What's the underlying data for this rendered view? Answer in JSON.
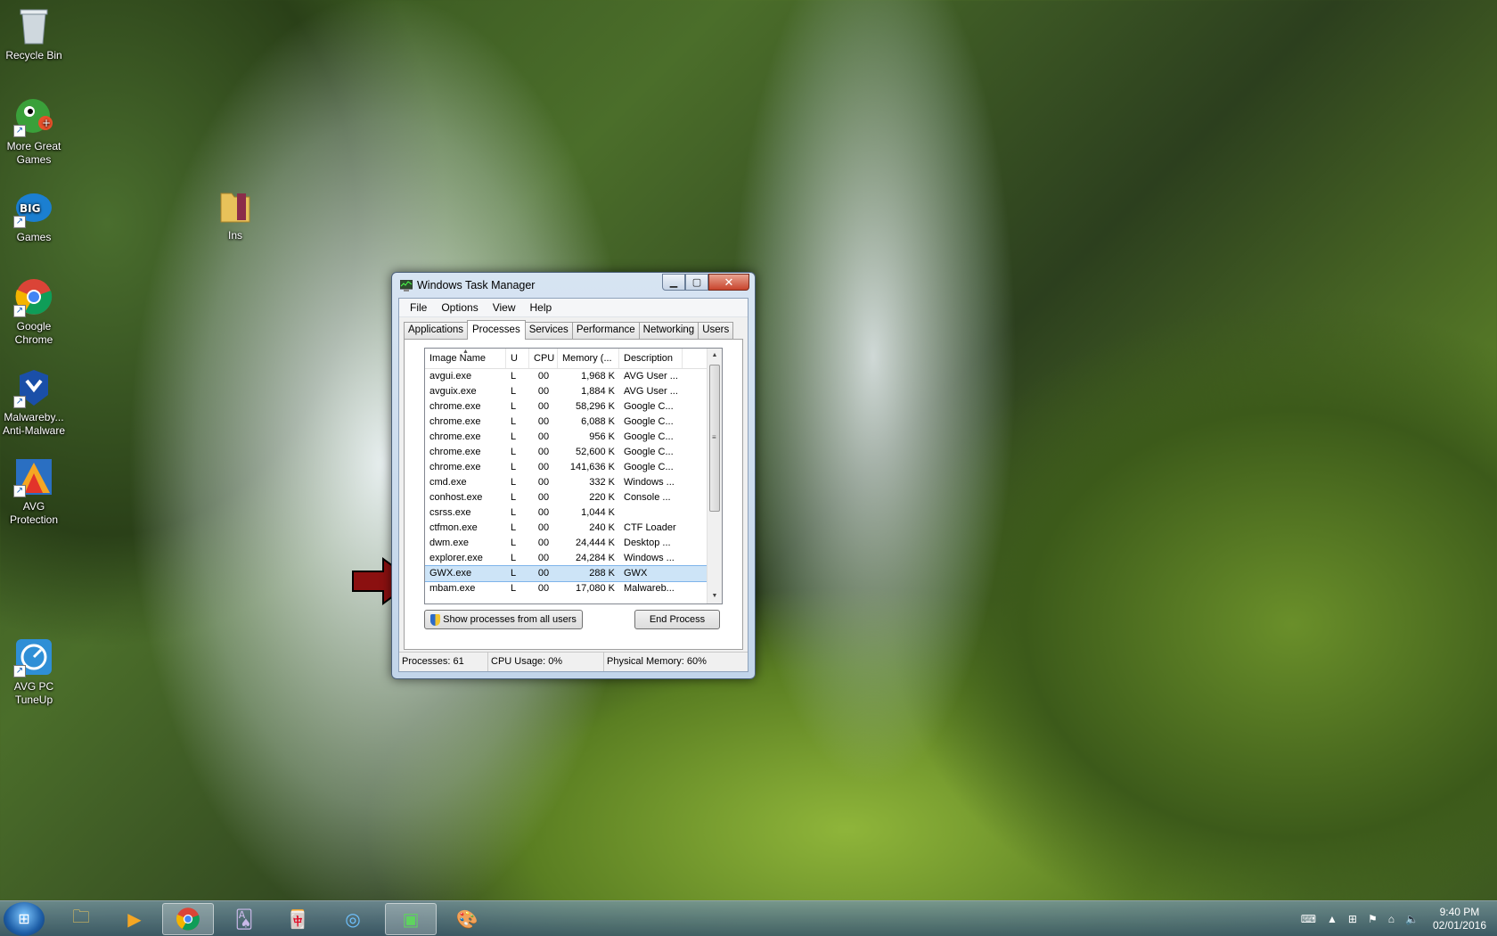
{
  "desktop": {
    "icons": [
      {
        "label": "Recycle Bin"
      },
      {
        "label": "More Great\nGames"
      },
      {
        "label": "Games"
      },
      {
        "label": "Google\nChrome"
      },
      {
        "label": "Malwareby...\nAnti-Malware"
      },
      {
        "label": "AVG\nProtection"
      },
      {
        "label": "AVG PC\nTuneUp"
      },
      {
        "label": "Ins"
      }
    ]
  },
  "window": {
    "title": "Windows Task Manager",
    "menu": [
      "File",
      "Options",
      "View",
      "Help"
    ],
    "tabs": [
      "Applications",
      "Processes",
      "Services",
      "Performance",
      "Networking",
      "Users"
    ],
    "active_tab": "Processes",
    "columns": [
      "Image Name",
      "U",
      "CPU",
      "Memory (...",
      "Description"
    ],
    "rows": [
      {
        "name": "avgui.exe",
        "user": "L",
        "cpu": "00",
        "mem": "1,968 K",
        "desc": "AVG User ..."
      },
      {
        "name": "avguix.exe",
        "user": "L",
        "cpu": "00",
        "mem": "1,884 K",
        "desc": "AVG User ..."
      },
      {
        "name": "chrome.exe",
        "user": "L",
        "cpu": "00",
        "mem": "58,296 K",
        "desc": "Google C..."
      },
      {
        "name": "chrome.exe",
        "user": "L",
        "cpu": "00",
        "mem": "6,088 K",
        "desc": "Google C..."
      },
      {
        "name": "chrome.exe",
        "user": "L",
        "cpu": "00",
        "mem": "956 K",
        "desc": "Google C..."
      },
      {
        "name": "chrome.exe",
        "user": "L",
        "cpu": "00",
        "mem": "52,600 K",
        "desc": "Google C..."
      },
      {
        "name": "chrome.exe",
        "user": "L",
        "cpu": "00",
        "mem": "141,636 K",
        "desc": "Google C..."
      },
      {
        "name": "cmd.exe",
        "user": "L",
        "cpu": "00",
        "mem": "332 K",
        "desc": "Windows ..."
      },
      {
        "name": "conhost.exe",
        "user": "L",
        "cpu": "00",
        "mem": "220 K",
        "desc": "Console ..."
      },
      {
        "name": "csrss.exe",
        "user": "L",
        "cpu": "00",
        "mem": "1,044 K",
        "desc": ""
      },
      {
        "name": "ctfmon.exe",
        "user": "L",
        "cpu": "00",
        "mem": "240 K",
        "desc": "CTF Loader"
      },
      {
        "name": "dwm.exe",
        "user": "L",
        "cpu": "00",
        "mem": "24,444 K",
        "desc": "Desktop ..."
      },
      {
        "name": "explorer.exe",
        "user": "L",
        "cpu": "00",
        "mem": "24,284 K",
        "desc": "Windows ..."
      },
      {
        "name": "GWX.exe",
        "user": "L",
        "cpu": "00",
        "mem": "288 K",
        "desc": "GWX",
        "selected": true
      },
      {
        "name": "mbam.exe",
        "user": "L",
        "cpu": "00",
        "mem": "17,080 K",
        "desc": "Malwareb..."
      }
    ],
    "show_all_label": "Show processes from all users",
    "end_process_label": "End Process",
    "status": {
      "processes": "Processes: 61",
      "cpu": "CPU Usage: 0%",
      "memory": "Physical Memory: 60%"
    }
  },
  "taskbar": {
    "time": "9:40 PM",
    "date": "02/01/2016"
  },
  "colors": {
    "arrow": "#8b1010",
    "selection": "#cde4f7",
    "window_frame": "#c2d5ea"
  }
}
